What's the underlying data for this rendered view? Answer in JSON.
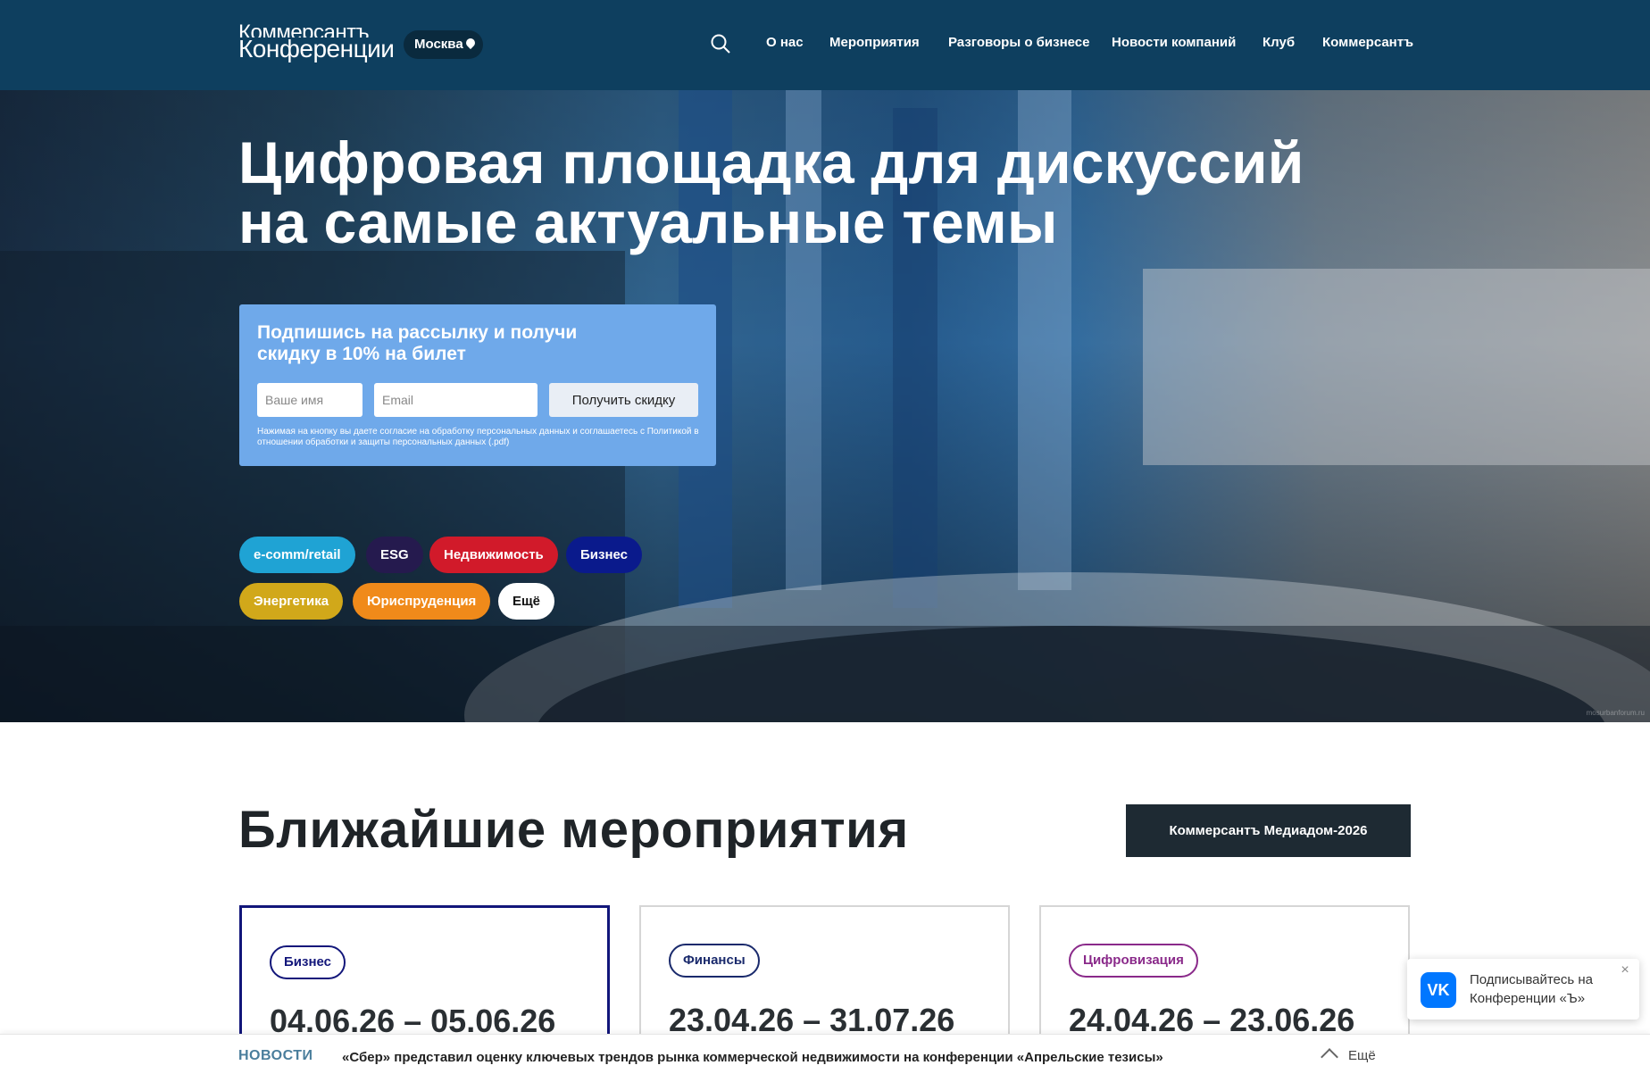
{
  "header": {
    "logo_line1": "Коммерсантъ",
    "logo_line2": "Конференции",
    "city": "Москва",
    "nav": [
      "О нас",
      "Мероприятия",
      "Разговоры о бизнесе",
      "Новости компаний",
      "Клуб",
      "Коммерсантъ"
    ]
  },
  "hero": {
    "title_line1": "Цифровая площадка для дискуссий",
    "title_line2": "на самые актуальные темы",
    "photo_credit": "mosurbanforum.ru"
  },
  "subscribe": {
    "title": "Подпишись на рассылку и получи скидку в 10% на билет",
    "name_placeholder": "Ваше имя",
    "email_placeholder": "Email",
    "button": "Получить скидку",
    "note": "Нажимая на кнопку вы даете согласие на обработку персональных данных и соглашаетесь с Политикой в отношении обработки и защиты персональных данных (.pdf)"
  },
  "tags": [
    {
      "label": "e-comm/retail",
      "color": "#1fa3d4"
    },
    {
      "label": "ESG",
      "color": "#251a4e"
    },
    {
      "label": "Недвижимость",
      "color": "#d11a2a"
    },
    {
      "label": "Бизнес",
      "color": "#0a1a8c"
    },
    {
      "label": "Энергетика",
      "color": "#d1a81a"
    },
    {
      "label": "Юриспруденция",
      "color": "#f08a1a"
    },
    {
      "label": "Ещё",
      "color": "#ffffff"
    }
  ],
  "events": {
    "title": "Ближайшие мероприятия",
    "featured_button": "Коммерсантъ Медиадом-2026",
    "cards": [
      {
        "badge": "Бизнес",
        "badge_color": "#12167a",
        "dates": "04.06.26 – 05.06.26"
      },
      {
        "badge": "Финансы",
        "badge_color": "#1a2a6c",
        "dates": "23.04.26 – 31.07.26"
      },
      {
        "badge": "Цифровизация",
        "badge_color": "#8a2a8a",
        "dates": "24.04.26 – 23.06.26"
      }
    ]
  },
  "vk_popup": {
    "logo": "VK",
    "text": "Подписывайтесь на Конференции «Ъ»",
    "close": "×"
  },
  "ticker": {
    "label": "НОВОСТИ",
    "text": "«Сбер» представил оценку ключевых трендов рынка коммерческой недвижимости на конференции «Апрельские тезисы»",
    "more": "Ещё"
  }
}
